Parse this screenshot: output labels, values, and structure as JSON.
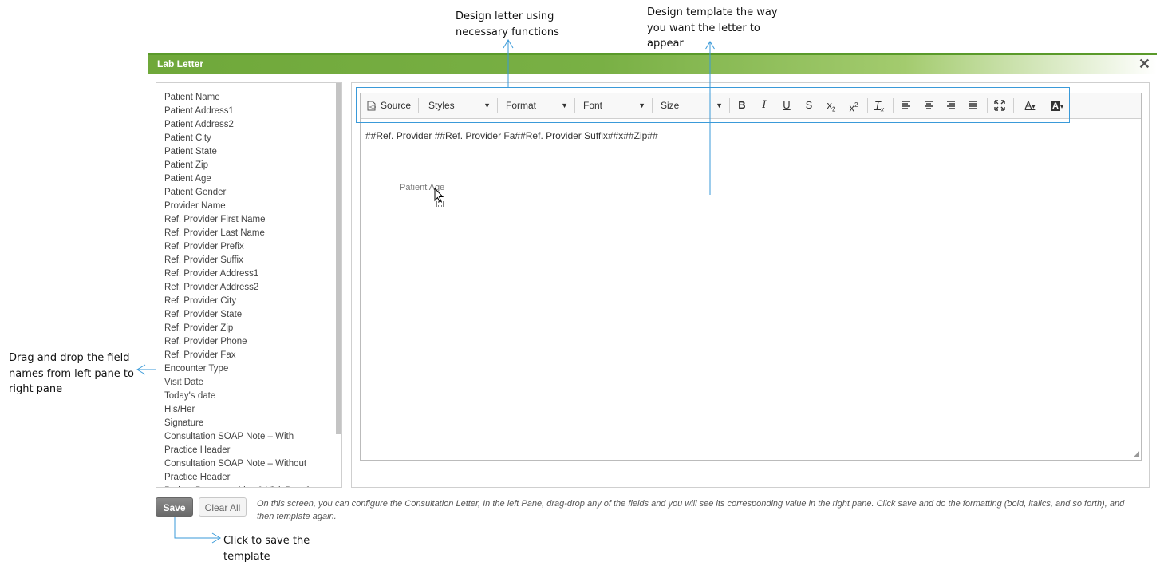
{
  "annotations": {
    "design_letter": "Design letter using\nnecessary functions",
    "design_template": "Design template the way\nyou want the letter to\nappear",
    "drag_drop": "Drag and drop the field\nnames from left pane to\nright pane",
    "save": "Click to save the\ntemplate"
  },
  "dialog": {
    "title": "Lab Letter",
    "close_icon": "✕"
  },
  "fields": [
    "Patient Name",
    "Patient Address1",
    "Patient Address2",
    "Patient City",
    "Patient State",
    "Patient Zip",
    "Patient Age",
    "Patient Gender",
    "Provider Name",
    "Ref. Provider First Name",
    "Ref. Provider Last Name",
    "Ref. Provider Prefix",
    "Ref. Provider Suffix",
    "Ref. Provider Address1",
    "Ref. Provider Address2",
    "Ref. Provider City",
    "Ref. Provider State",
    "Ref. Provider Zip",
    "Ref. Provider Phone",
    "Ref. Provider Fax",
    "Encounter Type",
    "Visit Date",
    "Today's date",
    "His/Her",
    "Signature",
    "Consultation SOAP Note – With",
    "Practice Header",
    "Consultation SOAP Note – Without",
    "Practice Header",
    "Patient Demographics & Visit Details"
  ],
  "toolbar": {
    "source": "Source",
    "styles": "Styles",
    "format": "Format",
    "font": "Font",
    "size": "Size"
  },
  "editor": {
    "content": "##Ref. Provider ##Ref. Provider Fa##Ref. Provider Suffix##x##Zip##",
    "dragged_field": "Patient Age"
  },
  "buttons": {
    "save": "Save",
    "clear": "Clear All"
  },
  "info_text": "On this screen, you can configure the Consultation Letter, In the left Pane, drag-drop any of the fields and you will see its corresponding value in the right pane. Click save and do the formatting (bold, italics, and so forth), and then template again.",
  "colors": {
    "accent": "#3a9ad9",
    "title_green": "#6fa83a"
  }
}
